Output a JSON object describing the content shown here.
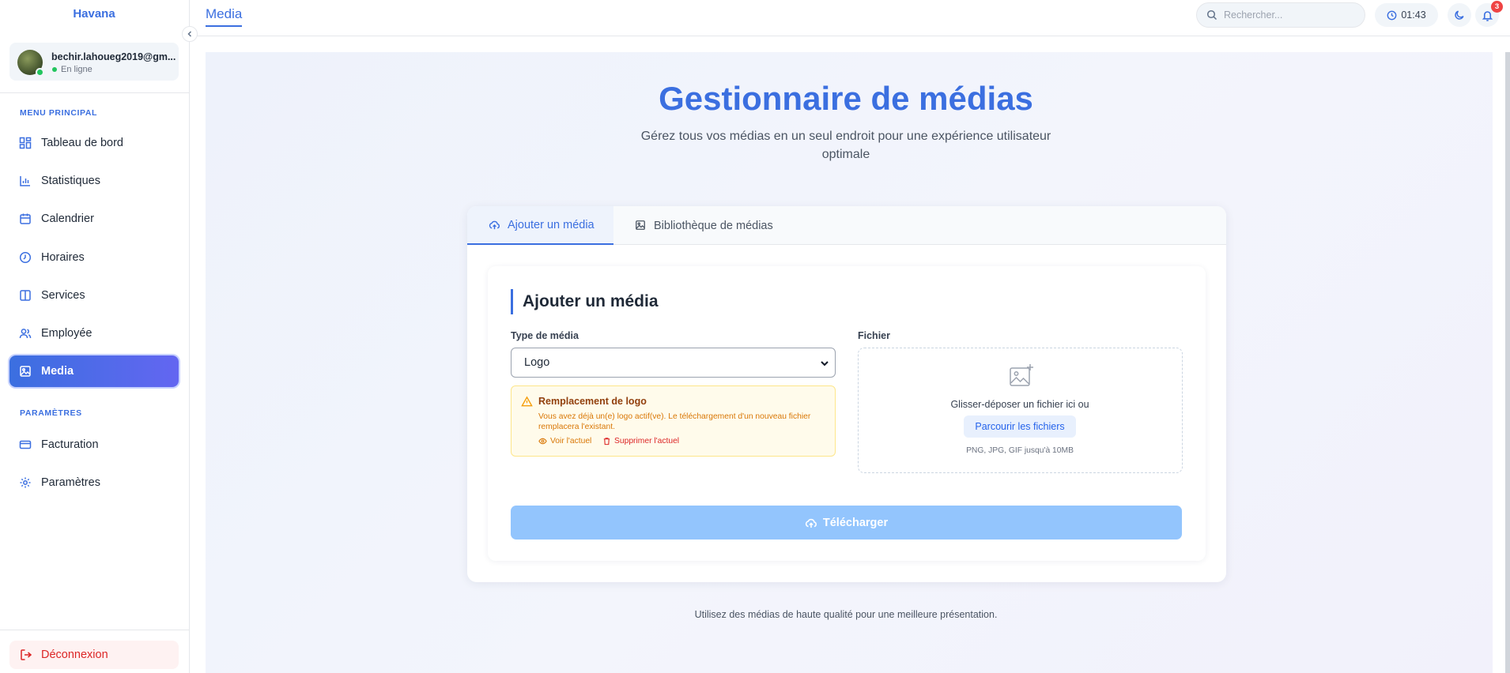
{
  "sidebar": {
    "brand": "Havana",
    "user": {
      "email": "bechir.lahoueg2019@gm...",
      "status": "En ligne"
    },
    "sections": {
      "main": "MENU PRINCIPAL",
      "settings": "PARAMÈTRES"
    },
    "items": [
      {
        "label": "Tableau de bord",
        "icon": "dashboard-icon"
      },
      {
        "label": "Statistiques",
        "icon": "bar-chart-icon"
      },
      {
        "label": "Calendrier",
        "icon": "calendar-icon"
      },
      {
        "label": "Horaires",
        "icon": "clock-icon"
      },
      {
        "label": "Services",
        "icon": "columns-icon"
      },
      {
        "label": "Employée",
        "icon": "users-icon"
      },
      {
        "label": "Media",
        "icon": "image-icon",
        "active": true
      }
    ],
    "settings_items": [
      {
        "label": "Facturation",
        "icon": "credit-card-icon"
      },
      {
        "label": "Paramètres",
        "icon": "gear-icon"
      }
    ],
    "logout": "Déconnexion"
  },
  "header": {
    "title": "Media",
    "search_placeholder": "Rechercher...",
    "time": "01:43",
    "notifications": "3"
  },
  "main": {
    "title": "Gestionnaire de médias",
    "subtitle": "Gérez tous vos médias en un seul endroit pour une expérience utilisateur optimale",
    "tabs": [
      {
        "label": "Ajouter un média",
        "active": true
      },
      {
        "label": "Bibliothèque de médias",
        "active": false
      }
    ],
    "form": {
      "title": "Ajouter un média",
      "type_label": "Type de média",
      "type_value": "Logo",
      "file_label": "Fichier",
      "warning": {
        "title": "Remplacement de logo",
        "text": "Vous avez déjà un(e) logo actif(ve). Le téléchargement d'un nouveau fichier remplacera l'existant.",
        "view_link": "Voir l'actuel",
        "delete_link": "Supprimer l'actuel"
      },
      "dropzone": {
        "text": "Glisser-déposer un fichier ici ou",
        "browse": "Parcourir les fichiers",
        "hint": "PNG, JPG, GIF jusqu'à 10MB"
      },
      "submit": "Télécharger"
    },
    "footer": "Utilisez des médias de haute qualité pour une meilleure présentation."
  },
  "colors": {
    "accent": "#3b6fe0",
    "warning": "#f59e0b",
    "danger": "#dc2626",
    "upload_disabled": "#93c5fd"
  }
}
